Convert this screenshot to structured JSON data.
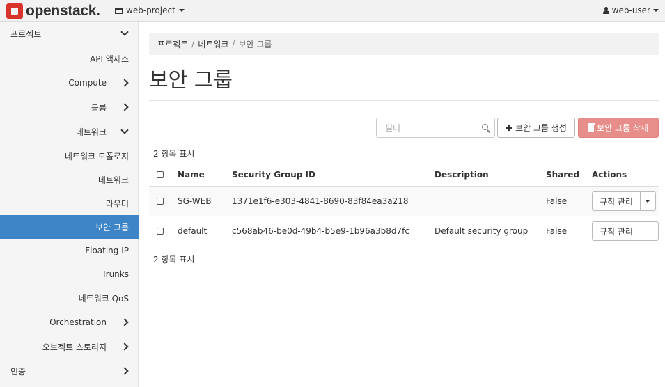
{
  "navbar": {
    "brand": "openstack.",
    "project": "web-project",
    "user": "web-user"
  },
  "sidebar": {
    "items": [
      {
        "label": "프로젝트"
      },
      {
        "label": "API 액세스"
      },
      {
        "label": "Compute"
      },
      {
        "label": "볼륨"
      },
      {
        "label": "네트워크"
      },
      {
        "label": "네트워크 토폴로지"
      },
      {
        "label": "네트워크"
      },
      {
        "label": "라우터"
      },
      {
        "label": "보안 그룹"
      },
      {
        "label": "Floating IP"
      },
      {
        "label": "Trunks"
      },
      {
        "label": "네트워크 QoS"
      },
      {
        "label": "Orchestration"
      },
      {
        "label": "오브젝트 스토리지"
      },
      {
        "label": "인증"
      }
    ]
  },
  "breadcrumb": [
    "프로젝트",
    "네트워크",
    "보안 그룹"
  ],
  "page_title": "보안 그룹",
  "filter": {
    "placeholder": "필터"
  },
  "buttons": {
    "create": "보안 그룹 생성",
    "delete": "보안 그룹 삭제"
  },
  "count_label": "2 항목 표시",
  "table": {
    "headers": [
      "Name",
      "Security Group ID",
      "Description",
      "Shared",
      "Actions"
    ],
    "rows": [
      {
        "name": "SG-WEB",
        "id": "1371e1f6-e303-4841-8690-83f84ea3a218",
        "description": "",
        "shared": "False",
        "action": "규칙 관리"
      },
      {
        "name": "default",
        "id": "c568ab46-be0d-49b4-b5e9-1b96a3b8d7fc",
        "description": "Default security group",
        "shared": "False",
        "action": "규칙 관리"
      }
    ]
  },
  "colors": {
    "active_nav": "#3d85c6",
    "delete_button": "#e88e8a",
    "brand_red": "#d9342b"
  }
}
